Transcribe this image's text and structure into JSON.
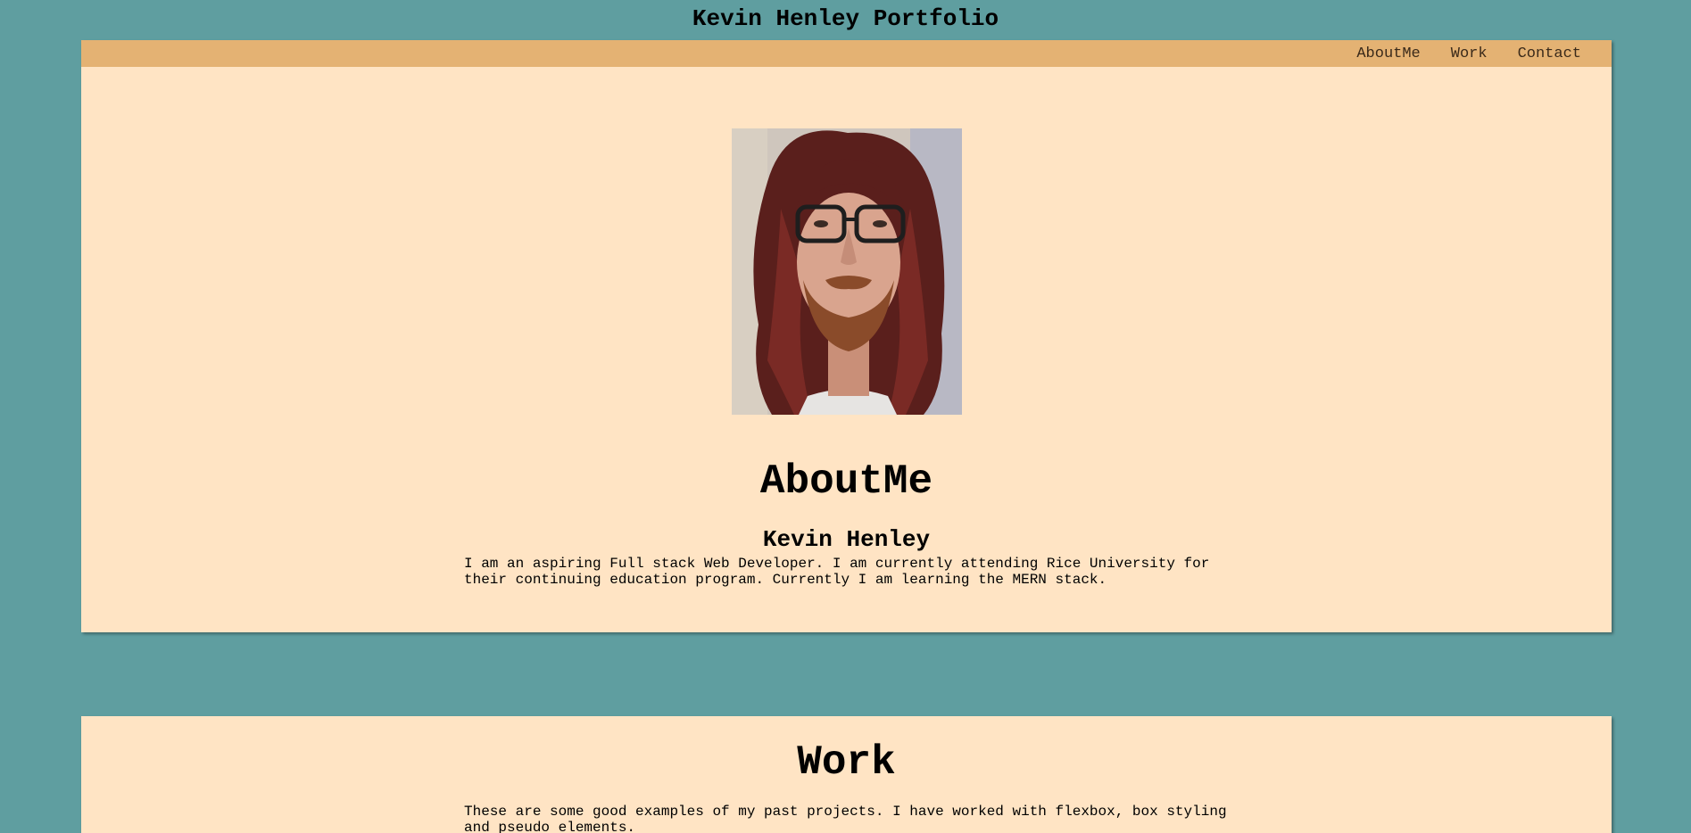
{
  "site": {
    "title": "Kevin Henley Portfolio"
  },
  "nav": {
    "items": [
      {
        "label": "AboutMe"
      },
      {
        "label": "Work"
      },
      {
        "label": "Contact"
      }
    ]
  },
  "about": {
    "heading": "AboutMe",
    "name": "Kevin Henley",
    "bio": "I am an aspiring Full stack Web Developer. I am currently attending Rice University for their continuing education program. Currently I am learning the MERN stack."
  },
  "work": {
    "heading": "Work",
    "intro": "These are some good examples of my past projects. I have worked with flexbox, box styling and pseudo elements."
  },
  "colors": {
    "page_background": "#5f9ea0",
    "panel_background": "#ffe4c4",
    "navbar_background": "#e4b273"
  }
}
